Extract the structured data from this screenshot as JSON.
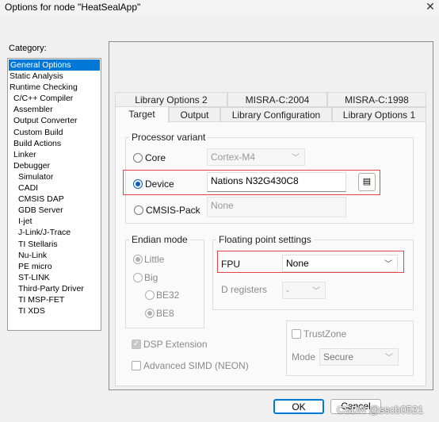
{
  "window": {
    "title": "Options for node \"HeatSealApp\"",
    "close_icon": "close-icon",
    "close_glyph": "✕"
  },
  "category": {
    "label": "Category:",
    "items": [
      {
        "label": "General Options",
        "level": 0,
        "selected": true
      },
      {
        "label": "Static Analysis",
        "level": 0
      },
      {
        "label": "Runtime Checking",
        "level": 0
      },
      {
        "label": "C/C++ Compiler",
        "level": 1
      },
      {
        "label": "Assembler",
        "level": 1
      },
      {
        "label": "Output Converter",
        "level": 1
      },
      {
        "label": "Custom Build",
        "level": 1
      },
      {
        "label": "Build Actions",
        "level": 1
      },
      {
        "label": "Linker",
        "level": 1
      },
      {
        "label": "Debugger",
        "level": 1
      },
      {
        "label": "Simulator",
        "level": 2
      },
      {
        "label": "CADI",
        "level": 2
      },
      {
        "label": "CMSIS DAP",
        "level": 2
      },
      {
        "label": "GDB Server",
        "level": 2
      },
      {
        "label": "I-jet",
        "level": 2
      },
      {
        "label": "J-Link/J-Trace",
        "level": 2
      },
      {
        "label": "TI Stellaris",
        "level": 2
      },
      {
        "label": "Nu-Link",
        "level": 2
      },
      {
        "label": "PE micro",
        "level": 2
      },
      {
        "label": "ST-LINK",
        "level": 2
      },
      {
        "label": "Third-Party Driver",
        "level": 2
      },
      {
        "label": "TI MSP-FET",
        "level": 2
      },
      {
        "label": "TI XDS",
        "level": 2
      }
    ]
  },
  "tabs": {
    "row1": [
      "Library Options 2",
      "MISRA-C:2004",
      "MISRA-C:1998"
    ],
    "row2": [
      "Target",
      "Output",
      "Library Configuration",
      "Library Options 1"
    ],
    "active": "Target"
  },
  "processor": {
    "title": "Processor variant",
    "core_label": "Core",
    "core_value": "Cortex-M4",
    "device_label": "Device",
    "device_value": "Nations N32G430C8",
    "cmsis_label": "CMSIS-Pack",
    "cmsis_value": "None",
    "selected": "Device",
    "highlight_color": "#e8414a"
  },
  "endian": {
    "title": "Endian mode",
    "little": "Little",
    "big": "Big",
    "be32": "BE32",
    "be8": "BE8"
  },
  "fp": {
    "title": "Floating point settings",
    "fpu_label": "FPU",
    "fpu_value": "None",
    "dreg_label": "D registers",
    "dreg_value": "-"
  },
  "trustzone": {
    "label": "TrustZone",
    "mode_label": "Mode",
    "mode_value": "Secure",
    "checked": false
  },
  "dsp": {
    "label": "DSP Extension",
    "checked": true
  },
  "simd": {
    "label": "Advanced SIMD (NEON)",
    "checked": false
  },
  "buttons": {
    "ok": "OK",
    "cancel": "Cancel"
  },
  "watermark": "CSDN @sscb0521"
}
